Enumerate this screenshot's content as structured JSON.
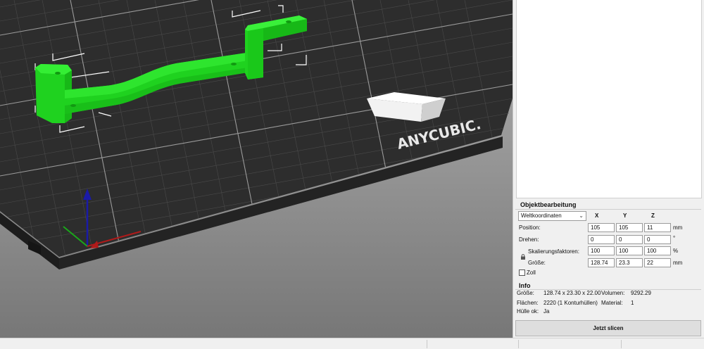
{
  "viewport": {
    "brand_text": "ANYCUBIC."
  },
  "object_edit": {
    "title": "Objektbearbeitung",
    "coord_system": "Weltkoordinaten",
    "axis_headers": [
      "X",
      "Y",
      "Z"
    ],
    "rows": [
      {
        "label": "Position:",
        "values": [
          "105",
          "105",
          "11"
        ],
        "unit": "mm"
      },
      {
        "label": "Drehen:",
        "values": [
          "0",
          "0",
          "0"
        ],
        "unit": "°"
      },
      {
        "label": "Skalierungsfaktoren:",
        "values": [
          "100",
          "100",
          "100"
        ],
        "unit": "%"
      },
      {
        "label": "Größe:",
        "values": [
          "128.74",
          "23.3",
          "22"
        ],
        "unit": "mm"
      }
    ],
    "inch_label": "Zoll",
    "inch_checked": false
  },
  "info": {
    "title": "Info",
    "size_label": "Größe:",
    "size_value": "128.74 x 23.30 x 22.00",
    "volume_label": "Volumen:",
    "volume_value": "9292.29",
    "faces_label": "Flächen:",
    "faces_value": "2220 (1 Konturhüllen)",
    "material_label": "Material:",
    "material_value": "1",
    "hull_label": "Hülle ok:",
    "hull_value": "Ja"
  },
  "slice_button": "Jetzt slicen",
  "colors": {
    "model": "#22dd22",
    "bed": "#2b2b2b",
    "background_top": "#a9a9a9",
    "background_bottom": "#7a7a7a"
  }
}
